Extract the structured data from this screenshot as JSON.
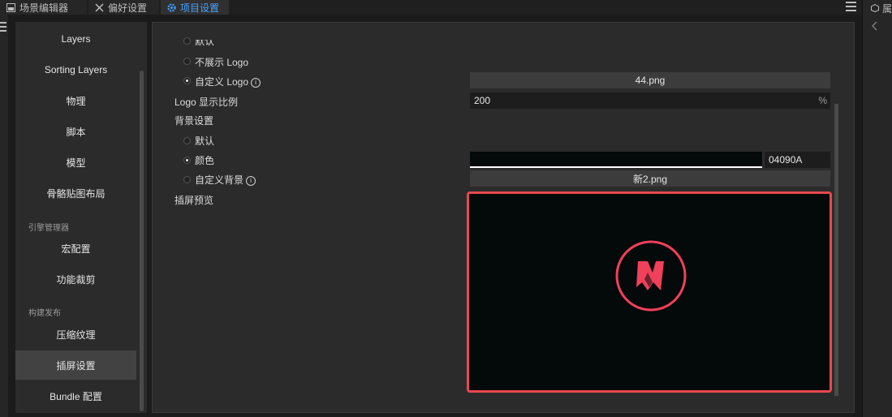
{
  "tabs": [
    {
      "label": "场景编辑器",
      "icon": "scene-editor-icon"
    },
    {
      "label": "偏好设置",
      "icon": "tools-icon"
    },
    {
      "label": "项目设置",
      "icon": "gear-icon"
    }
  ],
  "right_panel": {
    "label": "属",
    "icon": "cube-icon"
  },
  "nav": {
    "items_top": [
      "Layers",
      "Sorting Layers",
      "物理",
      "脚本",
      "模型",
      "骨骼贴图布局"
    ],
    "group_engine": "引擎管理器",
    "items_engine": [
      "宏配置",
      "功能裁剪"
    ],
    "group_build": "构建发布",
    "items_build": [
      "压缩纹理",
      "插屏设置",
      "Bundle 配置"
    ],
    "active": "插屏设置"
  },
  "form": {
    "logo_default": "默认",
    "logo_hide": "不展示 Logo",
    "logo_custom": "自定义 Logo",
    "logo_file": "44.png",
    "logo_ratio_label": "Logo 显示比例",
    "logo_ratio_value": "200",
    "logo_ratio_unit": "%",
    "bg_label": "背景设置",
    "bg_default": "默认",
    "bg_color": "颜色",
    "bg_color_hex": "04090A",
    "bg_color_value": "#04090a",
    "bg_custom": "自定义背景",
    "bg_file": "新2.png",
    "preview_label": "插屏预览"
  },
  "colors": {
    "accent": "#46a2ff",
    "highlight": "#e8484f",
    "logo": "#f0405a"
  }
}
